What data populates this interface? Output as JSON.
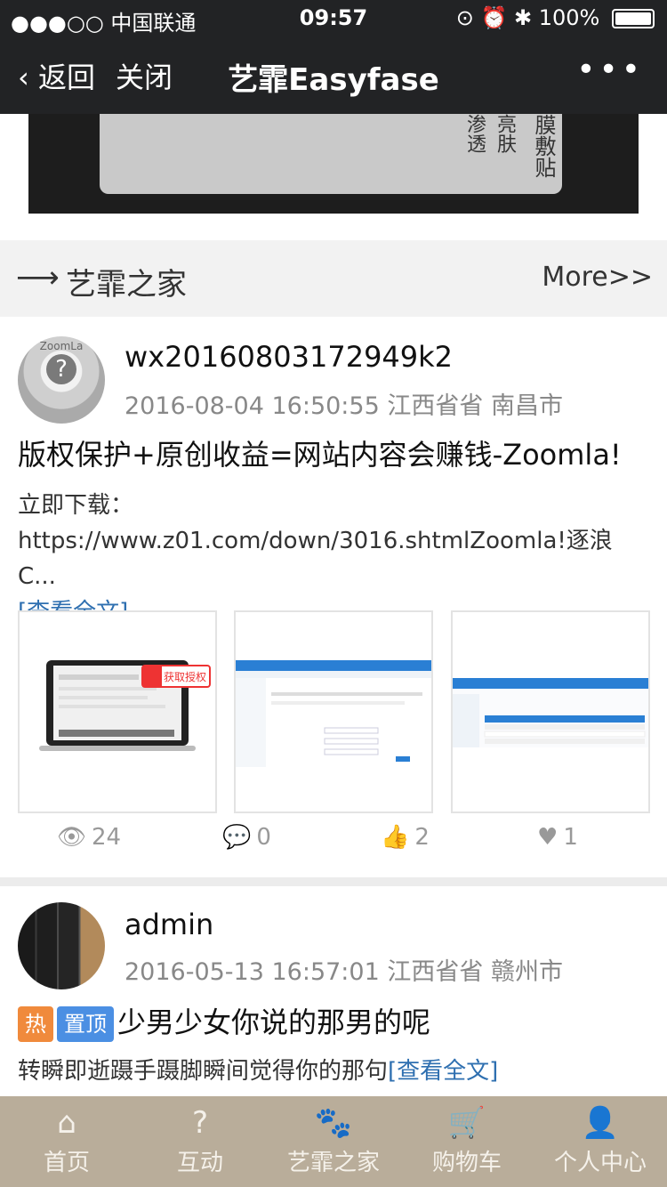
{
  "status_bar": {
    "carrier": "●●●○○ 中国联通",
    "time": "09:57",
    "battery": "100%"
  },
  "nav": {
    "back": "返回",
    "close": "关闭",
    "title": "艺霏Easyfase",
    "more": "•••"
  },
  "banner": {
    "box_text_1": "渗透",
    "box_text_2": "亮肤",
    "box_text_3": "膜敷贴"
  },
  "section": {
    "title": "艺霏之家",
    "more": "More>>"
  },
  "posts": [
    {
      "username": "wx20160803172949k2",
      "datetime": "2016-08-04 16:50:55",
      "location": "江西省省 南昌市",
      "title": "版权保护+原创收益=网站内容会赚钱-Zoomla!",
      "excerpt_line1": "立即下载：",
      "excerpt_line2": "https://www.z01.com/down/3016.shtmlZoomla!逐浪C...",
      "read_more": "[查看全文]",
      "thumb1_label": "获取授权",
      "views": "24",
      "comments": "0",
      "likes": "2",
      "favorites": "1"
    },
    {
      "username": "admin",
      "datetime": "2016-05-13 16:57:01",
      "location": "江西省省 赣州市",
      "tag_hot": "热",
      "tag_top": "置顶",
      "title": "少男少女你说的那男的呢",
      "excerpt": "转瞬即逝蹑手蹑脚瞬间觉得你的那句",
      "read_more": "[查看全文]"
    }
  ],
  "tabs": [
    {
      "label": "首页",
      "icon": "home-icon"
    },
    {
      "label": "互动",
      "icon": "question-icon"
    },
    {
      "label": "艺霏之家",
      "icon": "paw-icon"
    },
    {
      "label": "购物车",
      "icon": "cart-icon"
    },
    {
      "label": "个人中心",
      "icon": "user-icon"
    }
  ],
  "colors": {
    "nav_bg": "#222325",
    "tab_bg": "#b9ad9a",
    "link": "#2e6fb0",
    "tag_hot": "#f08a3c",
    "tag_top": "#4b8fe3"
  }
}
